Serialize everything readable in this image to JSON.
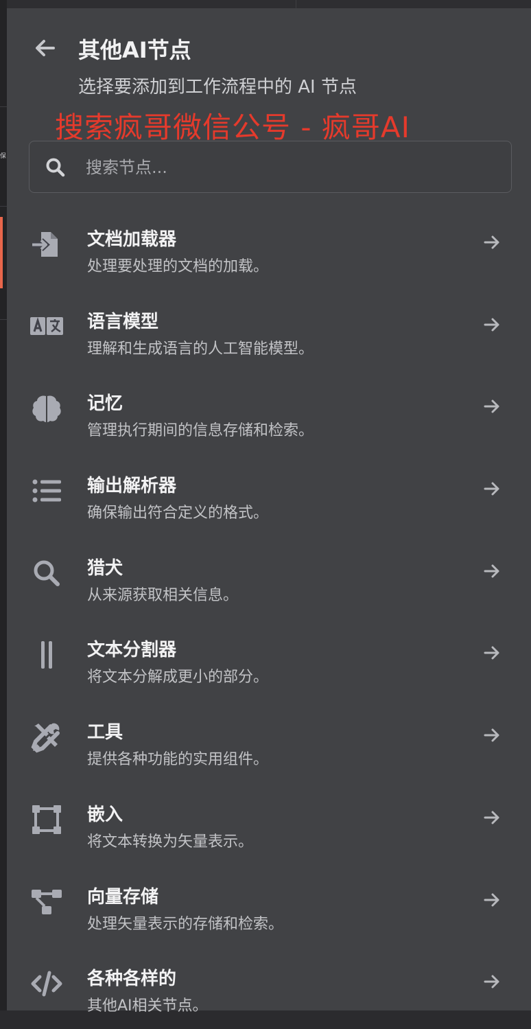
{
  "header": {
    "title": "其他AI节点",
    "subtitle": "选择要添加到工作流程中的 AI 节点",
    "watermark": "搜索疯哥微信公号 - 疯哥AI"
  },
  "left_strip": {
    "label": "保"
  },
  "search": {
    "placeholder": "搜索节点..."
  },
  "colors": {
    "panel_bg": "#414245",
    "accent": "#e8664b",
    "watermark": "#e53a2c",
    "icon": "#a9abb3"
  },
  "items": [
    {
      "title": "文档加载器",
      "description": "处理要处理的文档的加载。",
      "icon": "file-import-icon"
    },
    {
      "title": "语言模型",
      "description": "理解和生成语言的人工智能模型。",
      "icon": "language-icon"
    },
    {
      "title": "记忆",
      "description": "管理执行期间的信息存储和检索。",
      "icon": "brain-icon"
    },
    {
      "title": "输出解析器",
      "description": "确保输出符合定义的格式。",
      "icon": "list-icon"
    },
    {
      "title": "猎犬",
      "description": "从来源获取相关信息。",
      "icon": "search-icon"
    },
    {
      "title": "文本分割器",
      "description": "将文本分解成更小的部分。",
      "icon": "grip-lines-vertical-icon"
    },
    {
      "title": "工具",
      "description": "提供各种功能的实用组件。",
      "icon": "tools-icon"
    },
    {
      "title": "嵌入",
      "description": "将文本转换为矢量表示。",
      "icon": "vector-square-icon"
    },
    {
      "title": "向量存储",
      "description": "处理矢量表示的存储和检索。",
      "icon": "project-diagram-icon"
    },
    {
      "title": "各种各样的",
      "description": "其他AI相关节点。",
      "icon": "code-icon"
    }
  ]
}
